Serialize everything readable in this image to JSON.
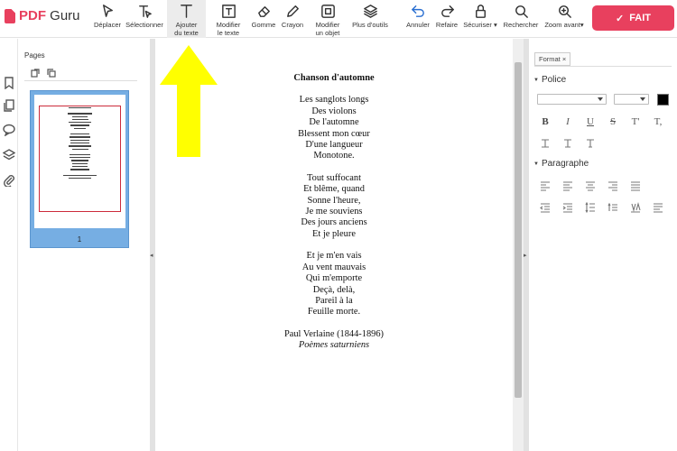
{
  "brand": {
    "name_part1": "PDF",
    "name_part2": " Guru",
    "color": "#e8405e"
  },
  "toolbar": {
    "tools": [
      {
        "id": "move",
        "label": "Déplacer",
        "icon": "cursor-icon"
      },
      {
        "id": "select",
        "label": "Sélectionner",
        "icon": "text-select-icon"
      },
      {
        "id": "add-text",
        "label": "Ajouter\ndu texte",
        "icon": "text-icon",
        "active": true
      },
      {
        "id": "edit-text",
        "label": "Modifier\nle texte",
        "icon": "edit-text-icon"
      },
      {
        "id": "eraser",
        "label": "Gomme",
        "icon": "eraser-icon"
      },
      {
        "id": "pencil",
        "label": "Crayon",
        "icon": "pencil-icon"
      },
      {
        "id": "edit-object",
        "label": "Modifier\nun objet",
        "icon": "object-icon"
      },
      {
        "id": "more-tools",
        "label": "Plus d'outils",
        "icon": "layers-icon"
      },
      {
        "id": "undo",
        "label": "Annuler",
        "icon": "undo-icon"
      },
      {
        "id": "redo",
        "label": "Refaire",
        "icon": "redo-icon"
      },
      {
        "id": "secure",
        "label": "Sécuriser",
        "icon": "lock-icon"
      },
      {
        "id": "search",
        "label": "Rechercher",
        "icon": "search-icon"
      },
      {
        "id": "zoom",
        "label": "Zoom avant",
        "icon": "zoom-in-icon"
      }
    ],
    "done_label": "FAIT"
  },
  "pages_panel": {
    "title": "Pages",
    "page_number": "1"
  },
  "document": {
    "title": "Chanson d'automne",
    "stanzas": [
      [
        "Les sanglots longs",
        "Des violons",
        "De l'automne",
        "Blessent mon cœur",
        "D'une langueur",
        "Monotone."
      ],
      [
        "Tout suffocant",
        "Et blême, quand",
        "Sonne l'heure,",
        "Je me souviens",
        "Des jours anciens",
        "Et je pleure"
      ],
      [
        "Et je m'en vais",
        "Au vent mauvais",
        "Qui m'emporte",
        "Deçà, delà,",
        "Pareil à la",
        "Feuille morte."
      ]
    ],
    "author": "Paul Verlaine (1844-1896)",
    "source": "Poèmes saturniens"
  },
  "format_panel": {
    "tab_label": "Format",
    "tab_close": "×",
    "font_section": "Police",
    "paragraph_section": "Paragraphe",
    "style_buttons": [
      "B",
      "I",
      "U",
      "S",
      "T'",
      "T,"
    ],
    "color_swatch": "#000000"
  },
  "annotation": {
    "arrow_color": "#ffff00"
  }
}
